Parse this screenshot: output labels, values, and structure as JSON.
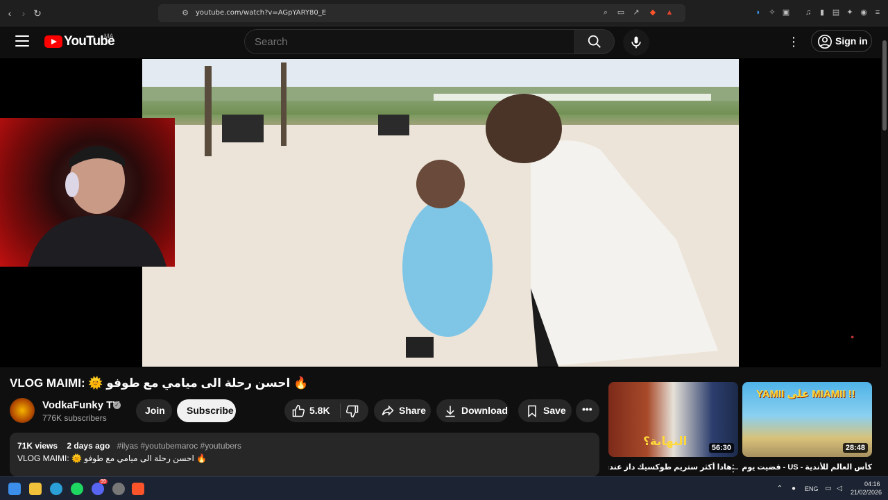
{
  "browser": {
    "url": "youtube.com/watch?v=AGpYARY80_E",
    "notification_count": "1"
  },
  "header": {
    "wordmark": "YouTube",
    "country_code": "MA",
    "search_placeholder": "Search",
    "signin_label": "Sign in"
  },
  "video": {
    "title": "VLOG MAIMI: 🌞 احسن رحلة الى ميامي مع طوفو 🔥",
    "channel_name": "VodkaFunky TV",
    "subscribers": "776K subscribers",
    "join_label": "Join",
    "subscribe_label": "Subscribe",
    "likes": "5.8K",
    "share_label": "Share",
    "download_label": "Download",
    "save_label": "Save"
  },
  "description": {
    "views": "71K views",
    "age": "2 days ago",
    "tags": "#ilyas #youtubemaroc #youtubers",
    "text": "VLOG MAIMI: 🌞 احسن رحلة الى ميامي مع طوفو 🔥"
  },
  "recommendations": [
    {
      "title": "...هادا أكثر ستريم طوكسيك داز عندي",
      "duration": "56:30",
      "thumb_text": "النهاية؟"
    },
    {
      "title": "كأس العالم للأندية - US - قضيت يوم في",
      "duration": "28:48",
      "thumb_text": "YAMII علی MIAMII !!"
    }
  ],
  "taskbar": {
    "language": "ENG",
    "time": "04:16",
    "date": "21/02/2026",
    "discord_badge": "99"
  },
  "colors": {
    "youtube_red": "#ff0000",
    "background": "#0f0f0f",
    "pill": "#272727"
  }
}
